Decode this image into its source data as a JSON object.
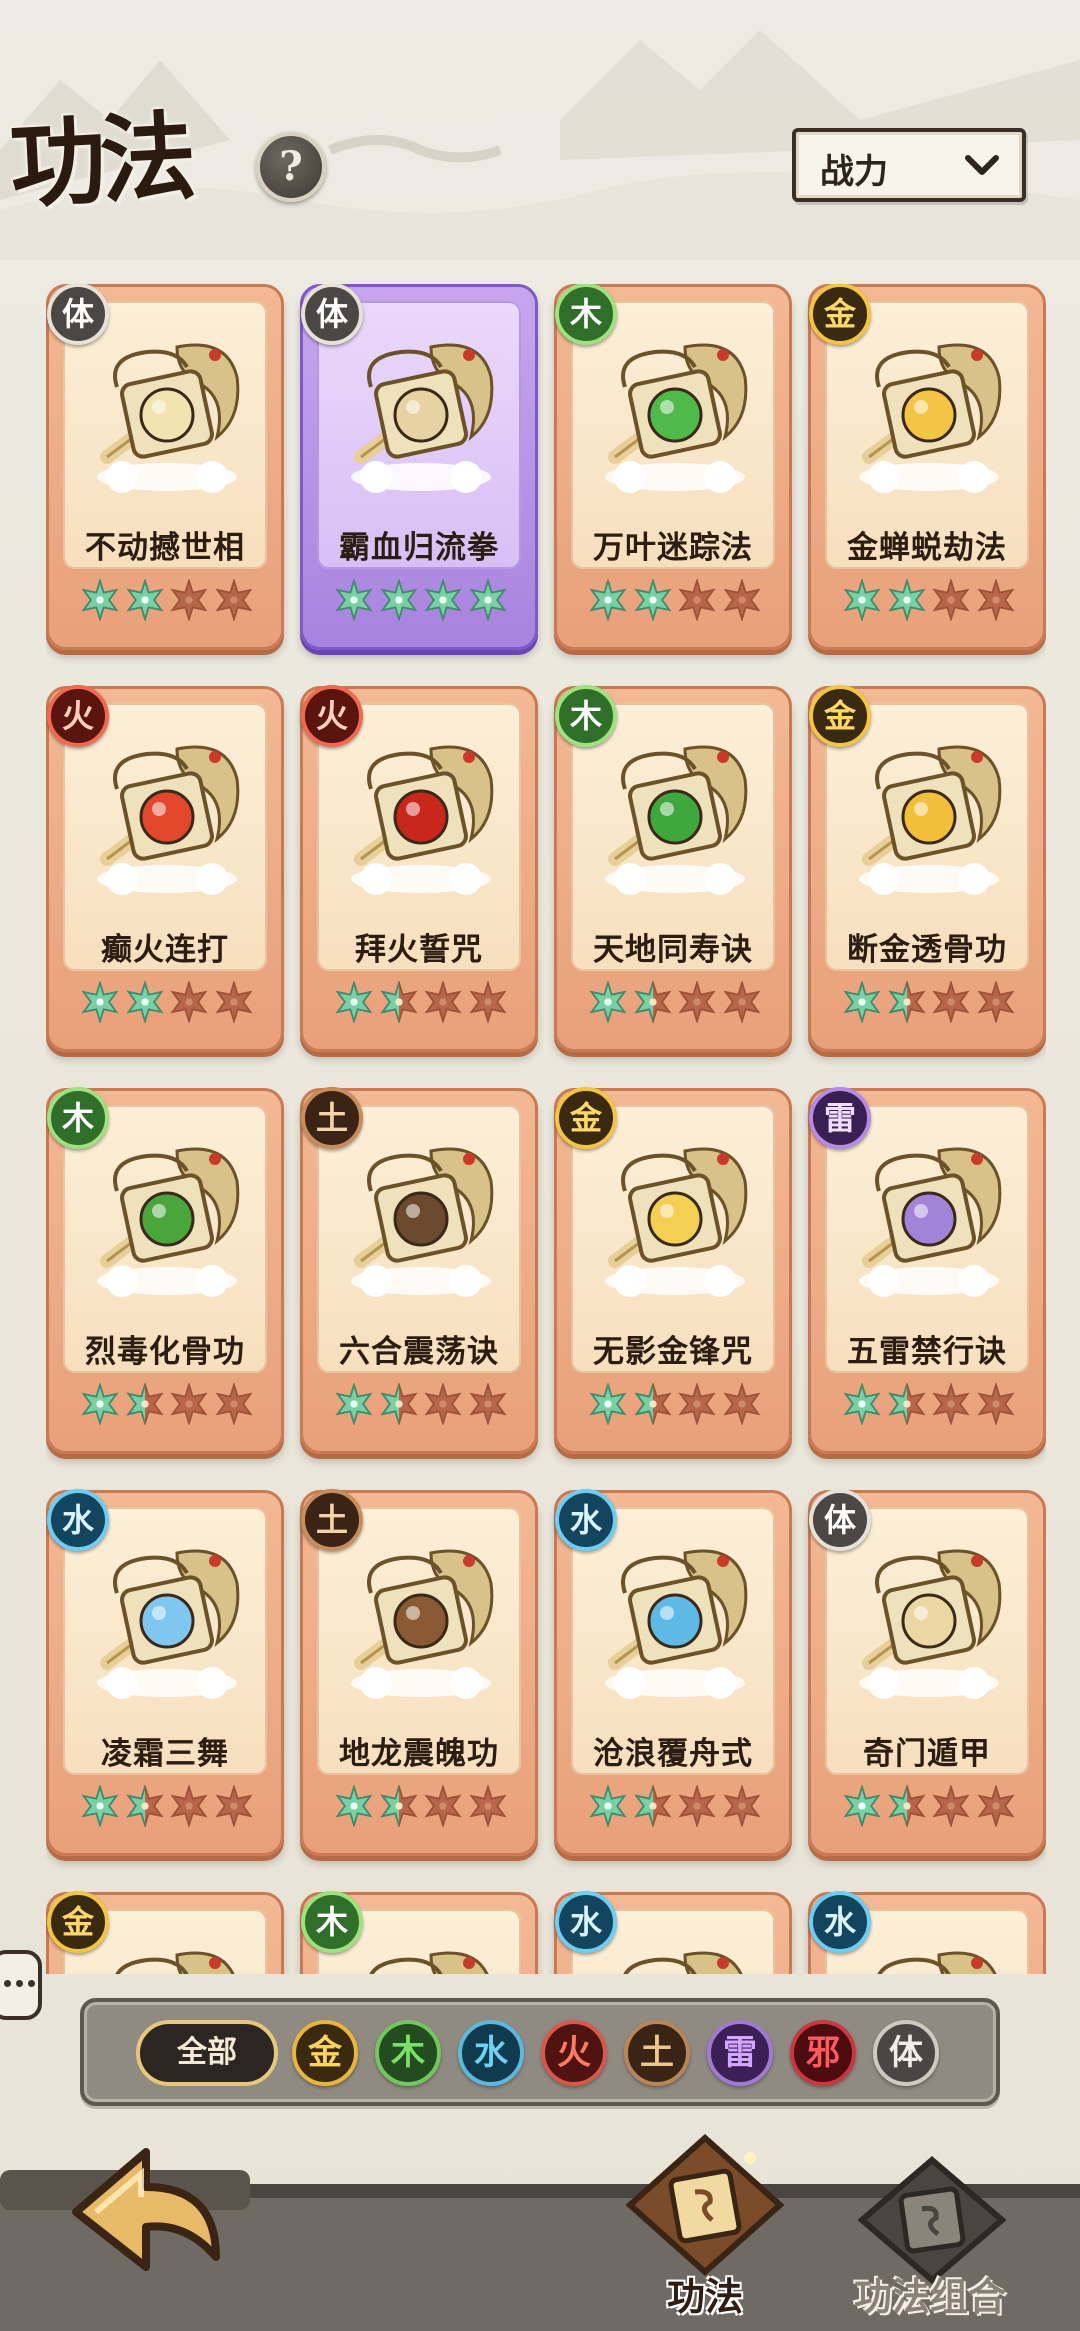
{
  "header": {
    "title": "功法",
    "help_label": "?",
    "sort": {
      "selected": "战力"
    }
  },
  "cards": [
    {
      "name": "不动撼世相",
      "element": "体",
      "el": "body",
      "stars": 2,
      "rarity": "orange",
      "art_color": "#f2e3b0"
    },
    {
      "name": "霸血归流拳",
      "element": "体",
      "el": "body",
      "stars": 4,
      "rarity": "purple",
      "art_color": "#e7d2a3"
    },
    {
      "name": "万叶迷踪法",
      "element": "木",
      "el": "wood",
      "stars": 2,
      "rarity": "orange",
      "art_color": "#4fb94a"
    },
    {
      "name": "金蝉蜕劫法",
      "element": "金",
      "el": "gold",
      "stars": 2,
      "rarity": "orange",
      "art_color": "#f4c544"
    },
    {
      "name": "癫火连打",
      "element": "火",
      "el": "fire",
      "stars": 2,
      "rarity": "orange",
      "art_color": "#e2472c"
    },
    {
      "name": "拜火誓咒",
      "element": "火",
      "el": "fire",
      "stars": 1.5,
      "rarity": "orange",
      "art_color": "#c9271c"
    },
    {
      "name": "天地同寿诀",
      "element": "木",
      "el": "wood",
      "stars": 1.5,
      "rarity": "orange",
      "art_color": "#3fa83c"
    },
    {
      "name": "断金透骨功",
      "element": "金",
      "el": "gold",
      "stars": 1.5,
      "rarity": "orange",
      "art_color": "#f2bf3a"
    },
    {
      "name": "烈毒化骨功",
      "element": "木",
      "el": "wood",
      "stars": 1.5,
      "rarity": "orange",
      "art_color": "#4aa63b"
    },
    {
      "name": "六合震荡诀",
      "element": "土",
      "el": "earth",
      "stars": 1.5,
      "rarity": "orange",
      "art_color": "#6b4a2e"
    },
    {
      "name": "无影金锋咒",
      "element": "金",
      "el": "gold",
      "stars": 1.5,
      "rarity": "orange",
      "art_color": "#f3cf54"
    },
    {
      "name": "五雷禁行诀",
      "element": "雷",
      "el": "thunder",
      "stars": 1.5,
      "rarity": "orange",
      "art_color": "#a184d9"
    },
    {
      "name": "凌霜三舞",
      "element": "水",
      "el": "water",
      "stars": 1.5,
      "rarity": "orange",
      "art_color": "#7fc7ef"
    },
    {
      "name": "地龙震魄功",
      "element": "土",
      "el": "earth",
      "stars": 1.5,
      "rarity": "orange",
      "art_color": "#8a5a34"
    },
    {
      "name": "沧浪覆舟式",
      "element": "水",
      "el": "water",
      "stars": 1.5,
      "rarity": "orange",
      "art_color": "#5fb9e6"
    },
    {
      "name": "奇门遁甲",
      "element": "体",
      "el": "body",
      "stars": 1.5,
      "rarity": "orange",
      "art_color": "#ead7a4"
    },
    {
      "name": "",
      "element": "金",
      "el": "gold",
      "stars": 0,
      "rarity": "orange",
      "art_color": "#f2bf3a"
    },
    {
      "name": "",
      "element": "木",
      "el": "wood",
      "stars": 0,
      "rarity": "orange",
      "art_color": "#4aa63b"
    },
    {
      "name": "",
      "element": "水",
      "el": "water",
      "stars": 0,
      "rarity": "orange",
      "art_color": "#5fb9e6"
    },
    {
      "name": "",
      "element": "水",
      "el": "water",
      "stars": 0,
      "rarity": "orange",
      "art_color": "#5fb9e6"
    }
  ],
  "filters": {
    "all_label": "全部",
    "chips": [
      {
        "label": "金",
        "cls": "gold"
      },
      {
        "label": "木",
        "cls": "wood"
      },
      {
        "label": "水",
        "cls": "water"
      },
      {
        "label": "火",
        "cls": "fire"
      },
      {
        "label": "土",
        "cls": "earth"
      },
      {
        "label": "雷",
        "cls": "thunder"
      },
      {
        "label": "邪",
        "cls": "evil"
      },
      {
        "label": "体",
        "cls": "body"
      }
    ]
  },
  "nav": {
    "tab_skills": "功法",
    "tab_combos": "功法组合"
  },
  "colors": {
    "star_filled": "#7ad0a4",
    "star_empty": "#b8664a",
    "card_orange": "#eba57f",
    "card_purple": "#b58ee6"
  }
}
